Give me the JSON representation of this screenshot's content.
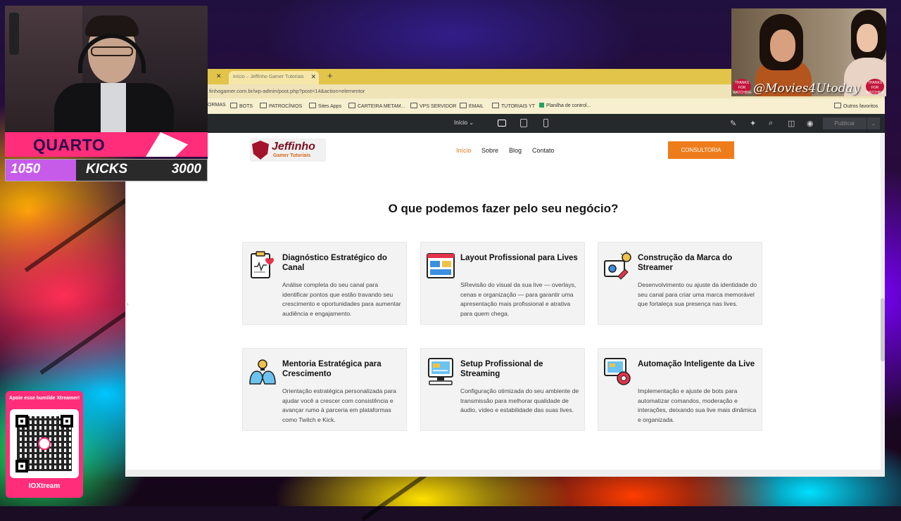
{
  "stream": {
    "goal": {
      "label": "QUARTO",
      "current": "1050",
      "name": "KICKS",
      "target": "3000",
      "progress": 0.35
    },
    "movie_handle": "@Movies4Utoday",
    "badge_text": "THANKS FOR WATCHING",
    "qr": {
      "title": "Apoie esse humilde Xtreamer!",
      "brand": "IOXtream"
    }
  },
  "browser": {
    "tab_title": "Início – Jeffinho Gamer Tutoriais",
    "url": "finhogamer.com.br/wp-admin/post.php?post=14&action=elementor",
    "bookmarks": [
      "ORMAS",
      "BOTS",
      "PATROCÍNIOS",
      "Sites Apps",
      "CARTEIRA METAM...",
      "VPS SERVIDOR",
      "EMAIL",
      "TUTORIAIS YT",
      "Planilha de control..."
    ],
    "other_bookmarks": "Outros favoritos"
  },
  "editor": {
    "page_selector": "Início",
    "publish_label": "Publicar"
  },
  "site": {
    "logo_name": "Jeffinho",
    "logo_sub": "Gamer Tutoriais",
    "nav": [
      "Início",
      "Sobre",
      "Blog",
      "Contato"
    ],
    "cta": "CONSULTORIA",
    "section_title": "O que podemos fazer pelo seu negócio?",
    "cards": [
      {
        "title": "Diagnóstico Estratégico do Canal",
        "text": "Análise completa do seu canal para identificar pontos que estão travando seu crescimento e oportunidades para aumentar audiência e engajamento.",
        "icon": "clipboard-heart-icon"
      },
      {
        "title": "Layout Profissional para Lives",
        "text": "SRevisão do visual da sua live — overlays, cenas e organização — para garantir uma apresentação mais profissional e atrativa para quem chega.",
        "icon": "layout-window-icon"
      },
      {
        "title": "Construção da Marca do Streamer",
        "text": "Desenvolvimento ou ajuste da identidade do seu canal para criar uma marca memorável que fortaleça sua presença nas lives.",
        "icon": "brand-idea-icon"
      },
      {
        "title": "Mentoria Estratégica para Crescimento",
        "text": "Orientação estratégica personalizada para ajudar você a crescer com consistência e avançar rumo à parceria em plataformas como Twitch e Kick.",
        "icon": "mentoring-heads-icon"
      },
      {
        "title": "Setup Profissional de Streaming",
        "text": "Configuração otimizada do seu ambiente de transmissão para melhorar qualidade de áudio, vídeo e estabilidade das suas lives.",
        "icon": "computer-setup-icon"
      },
      {
        "title": "Automação Inteligente da Live",
        "text": "Implementação e ajuste de bots para automatizar comandos, moderação e interações, deixando sua live mais dinâmica e organizada.",
        "icon": "automation-gear-icon"
      }
    ]
  },
  "colors": {
    "accent": "#ef7c1b",
    "brand": "#7a0f22",
    "goal_pink": "#ff2d7a",
    "goal_fill": "#c65bea"
  }
}
